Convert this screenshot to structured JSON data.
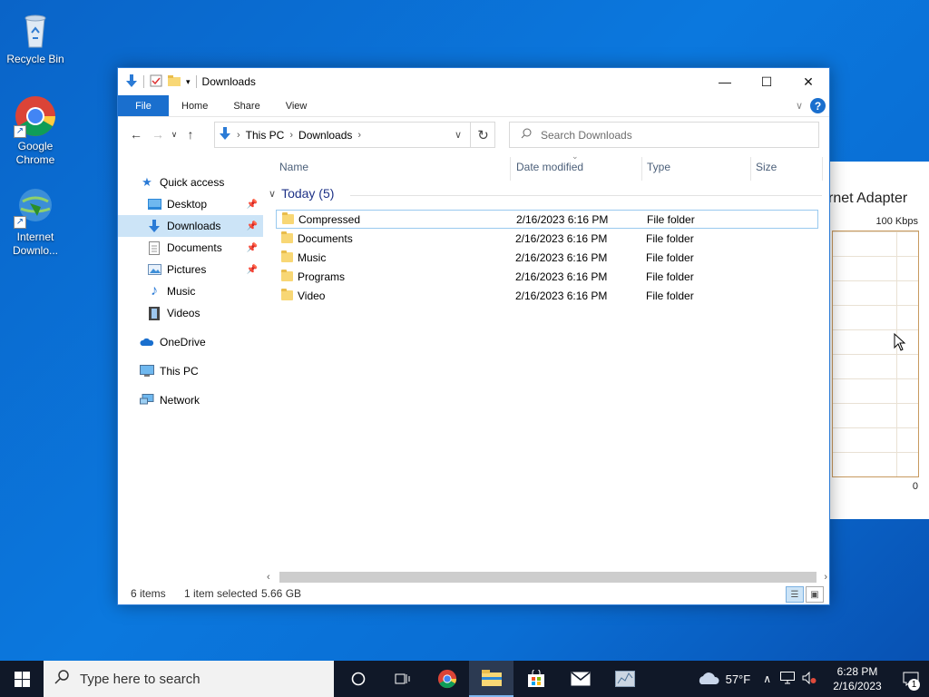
{
  "desktop": {
    "icons": [
      {
        "label": "Recycle Bin"
      },
      {
        "label": "Google Chrome"
      },
      {
        "label": "Internet Downlo..."
      }
    ]
  },
  "background_window": {
    "title": "rnet Adapter",
    "speed_label": "100 Kbps",
    "zero_label": "0"
  },
  "explorer": {
    "title": "Downloads",
    "ribbon_tabs": [
      "File",
      "Home",
      "Share",
      "View"
    ],
    "address": {
      "crumbs": [
        "This PC",
        "Downloads"
      ]
    },
    "search_placeholder": "Search Downloads",
    "nav": {
      "quick_access": "Quick access",
      "items": [
        {
          "label": "Desktop",
          "pinned": true
        },
        {
          "label": "Downloads",
          "pinned": true,
          "selected": true
        },
        {
          "label": "Documents",
          "pinned": true
        },
        {
          "label": "Pictures",
          "pinned": true
        },
        {
          "label": "Music"
        },
        {
          "label": "Videos"
        }
      ],
      "onedrive": "OneDrive",
      "this_pc": "This PC",
      "network": "Network"
    },
    "columns": [
      "Name",
      "Date modified",
      "Type",
      "Size"
    ],
    "group": "Today (5)",
    "files": [
      {
        "name": "Compressed",
        "date": "2/16/2023 6:16 PM",
        "type": "File folder",
        "selected": true
      },
      {
        "name": "Documents",
        "date": "2/16/2023 6:16 PM",
        "type": "File folder"
      },
      {
        "name": "Music",
        "date": "2/16/2023 6:16 PM",
        "type": "File folder"
      },
      {
        "name": "Programs",
        "date": "2/16/2023 6:16 PM",
        "type": "File folder"
      },
      {
        "name": "Video",
        "date": "2/16/2023 6:16 PM",
        "type": "File folder"
      }
    ],
    "status": {
      "count": "6 items",
      "selected": "1 item selected",
      "size": "5.66 GB"
    }
  },
  "taskbar": {
    "search_placeholder": "Type here to search",
    "weather": "57°F",
    "time": "6:28 PM",
    "date": "2/16/2023",
    "notification_count": "1"
  },
  "colors": {
    "accent": "#1a6fce",
    "selection": "#cce4f7",
    "taskbar": "#101828"
  }
}
